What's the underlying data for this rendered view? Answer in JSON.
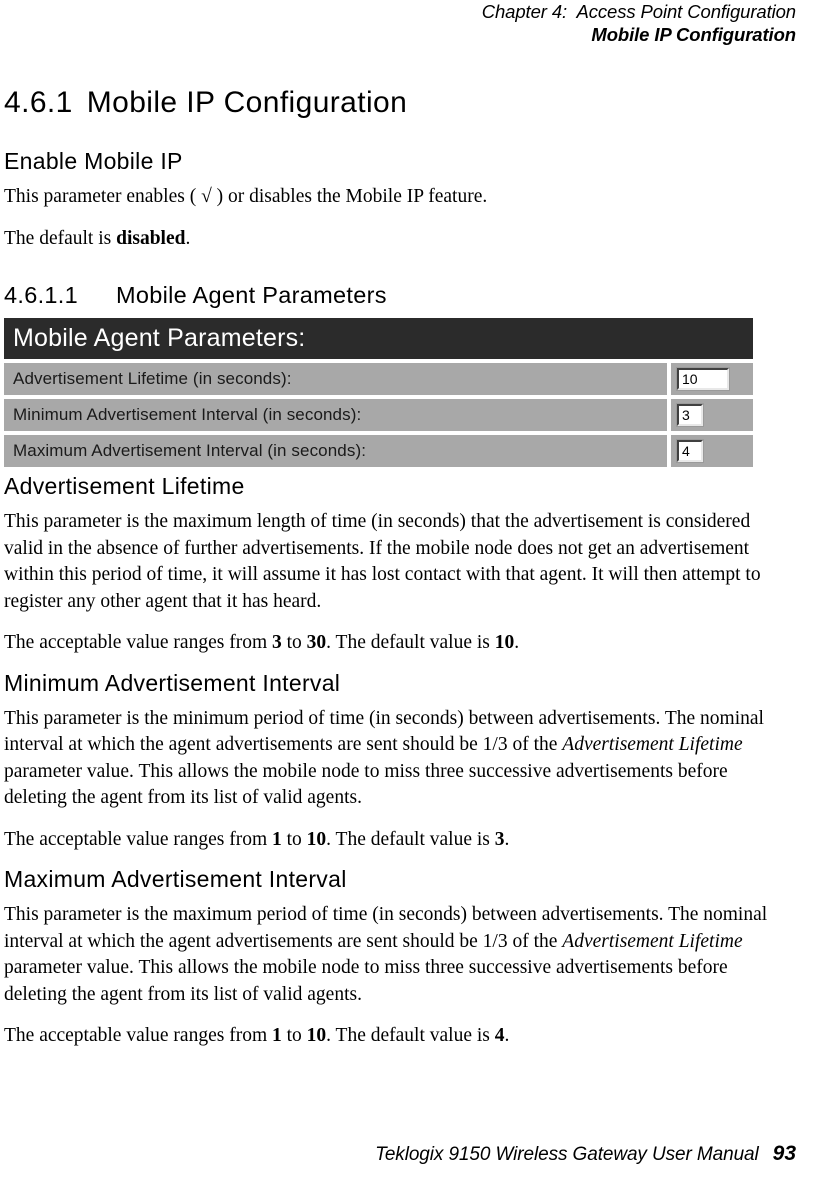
{
  "header": {
    "line1": "Chapter 4:  Access Point Configuration",
    "line2": "Mobile IP Configuration"
  },
  "section": {
    "number": "4.6.1",
    "title": "Mobile IP Configuration"
  },
  "enable_mobile_ip": {
    "heading": "Enable Mobile IP",
    "paragraph": "This parameter enables ( √ ) or disables the Mobile IP feature.",
    "default_prefix": "The default is ",
    "default_value": "disabled",
    "default_suffix": "."
  },
  "mobile_agent_parameters": {
    "number": "4.6.1.1",
    "heading": "Mobile Agent Parameters"
  },
  "ui_panel": {
    "title": "Mobile Agent Parameters:",
    "rows": [
      {
        "label": "Advertisement Lifetime (in seconds):",
        "value": "10"
      },
      {
        "label": "Minimum Advertisement Interval (in seconds):",
        "value": "3"
      },
      {
        "label": "Maximum Advertisement Interval (in seconds):",
        "value": "4"
      }
    ],
    "colors": {
      "titlebar_bg": "#2b2b2b",
      "titlebar_fg": "#ffffff",
      "row_bg": "#a8a8a8",
      "input_bg": "#ffffff"
    }
  },
  "advertisement_lifetime": {
    "heading": "Advertisement Lifetime",
    "paragraph": "This parameter is the maximum length of time (in seconds) that the advertisement is considered valid in the absence of further advertisements. If the mobile node does not get an advertisement within this period of time, it will assume it has lost contact with that agent. It will then attempt to register any other agent that it has heard.",
    "range_prefix": "The acceptable value ranges from ",
    "range_min": "3",
    "range_mid": " to ",
    "range_max": "30",
    "default_prefix": ". The default value is ",
    "default_value": "10",
    "default_suffix": "."
  },
  "minimum_advertisement_interval": {
    "heading": "Minimum Advertisement Interval",
    "para_part1": "This parameter is the minimum period of time (in seconds) between advertisements. The nominal interval at which the agent advertisements are sent should be 1/3 of the ",
    "para_italic": "Advertisement Lifetime",
    "para_part2": " parameter value. This allows the mobile node to miss three successive advertisements before deleting the agent from its list of valid agents.",
    "range_prefix": "The acceptable value ranges from ",
    "range_min": "1",
    "range_mid": " to ",
    "range_max": "10",
    "default_prefix": ". The default value is ",
    "default_value": "3",
    "default_suffix": "."
  },
  "maximum_advertisement_interval": {
    "heading": "Maximum Advertisement Interval",
    "para_part1": "This parameter is the maximum period of time (in seconds) between advertisements. The nominal interval at which the agent advertisements are sent should be 1/3 of the ",
    "para_italic": "Advertisement Lifetime",
    "para_part2": " parameter value. This allows the mobile node to miss three successive advertisements before deleting the agent from its list of valid agents.",
    "range_prefix": "The acceptable value ranges from ",
    "range_min": "1",
    "range_mid": " to ",
    "range_max": "10",
    "default_prefix": ". The default value is ",
    "default_value": "4",
    "default_suffix": "."
  },
  "footer": {
    "manual_title": "Teklogix 9150 Wireless Gateway User Manual",
    "page_number": "93"
  }
}
